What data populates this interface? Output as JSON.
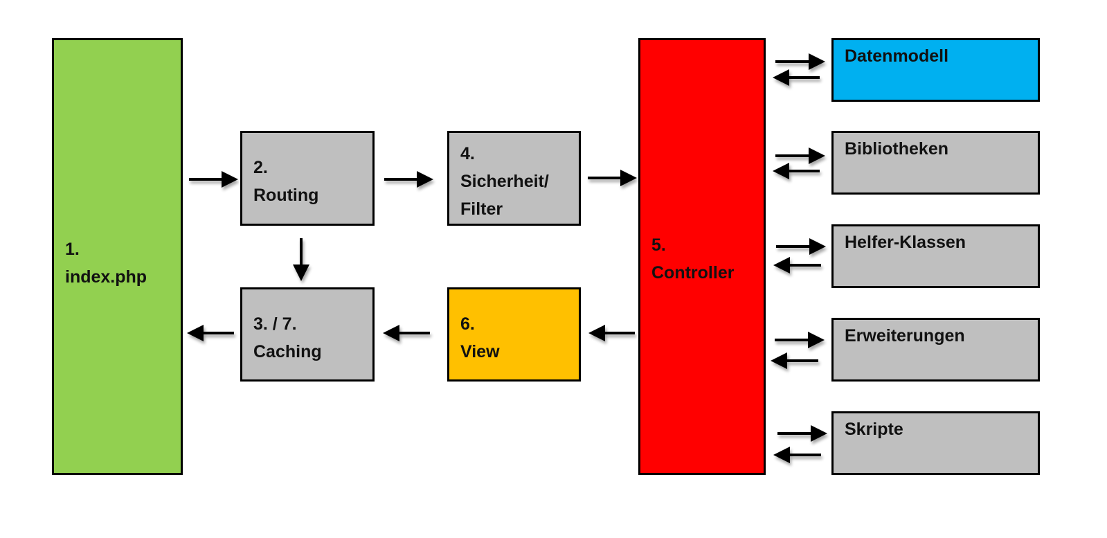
{
  "diagram": {
    "nodes": [
      {
        "id": "index",
        "lines": [
          "1.",
          "index.php"
        ],
        "color": "#92d050"
      },
      {
        "id": "routing",
        "lines": [
          "2.",
          "Routing"
        ],
        "color": "#bfbfbf"
      },
      {
        "id": "caching",
        "lines": [
          "3. / 7.",
          "Caching"
        ],
        "color": "#bfbfbf"
      },
      {
        "id": "security",
        "lines": [
          "4.",
          "Sicherheit/",
          "Filter"
        ],
        "color": "#bfbfbf"
      },
      {
        "id": "controller",
        "lines": [
          "5.",
          "Controller"
        ],
        "color": "#ff0000"
      },
      {
        "id": "view",
        "lines": [
          "6.",
          "View"
        ],
        "color": "#ffc000"
      },
      {
        "id": "datamodel",
        "lines": [
          "Datenmodell"
        ],
        "color": "#00b0f0"
      },
      {
        "id": "libraries",
        "lines": [
          "Bibliotheken"
        ],
        "color": "#bfbfbf"
      },
      {
        "id": "helpers",
        "lines": [
          "Helfer-Klassen"
        ],
        "color": "#bfbfbf"
      },
      {
        "id": "extensions",
        "lines": [
          "Erweiterungen"
        ],
        "color": "#bfbfbf"
      },
      {
        "id": "scripts",
        "lines": [
          "Skripte"
        ],
        "color": "#bfbfbf"
      }
    ],
    "edges": [
      {
        "from": "index",
        "to": "routing"
      },
      {
        "from": "routing",
        "to": "security"
      },
      {
        "from": "security",
        "to": "controller"
      },
      {
        "from": "routing",
        "to": "caching"
      },
      {
        "from": "controller",
        "to": "view"
      },
      {
        "from": "view",
        "to": "caching"
      },
      {
        "from": "caching",
        "to": "index"
      },
      {
        "from": "controller",
        "to": "datamodel",
        "bidirectional": true
      },
      {
        "from": "controller",
        "to": "libraries",
        "bidirectional": true
      },
      {
        "from": "controller",
        "to": "helpers",
        "bidirectional": true
      },
      {
        "from": "controller",
        "to": "extensions",
        "bidirectional": true
      },
      {
        "from": "controller",
        "to": "scripts",
        "bidirectional": true
      }
    ]
  }
}
